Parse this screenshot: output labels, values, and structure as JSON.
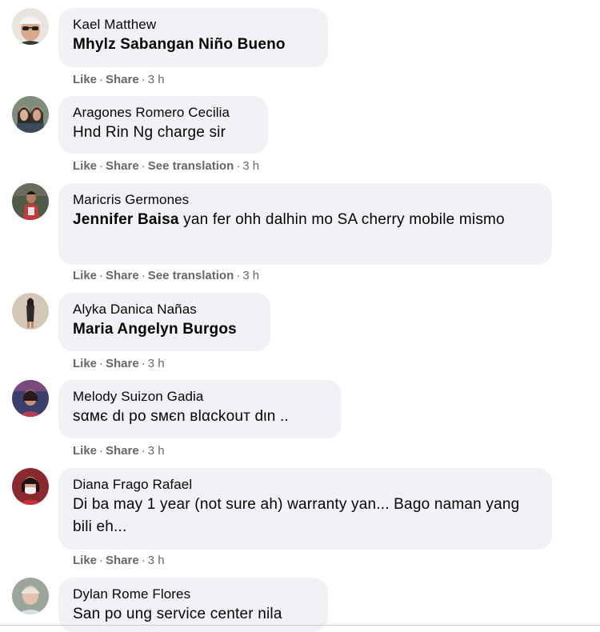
{
  "comments": [
    {
      "author": "Kael Matthew",
      "mention": "Mhylz Sabangan Niño Bueno",
      "text": "",
      "actions": {
        "like": "Like",
        "share": "Share",
        "translate": "",
        "time": "3 h"
      }
    },
    {
      "author": "Aragones Romero Cecilia",
      "mention": "",
      "text": "Hnd Rin Ng charge sir",
      "actions": {
        "like": "Like",
        "share": "Share",
        "translate": "See translation",
        "time": "3 h"
      }
    },
    {
      "author": "Maricris Germones",
      "mention": "Jennifer Baisa",
      "text": " yan fer ohh dalhin mo SA cherry mobile mismo",
      "actions": {
        "like": "Like",
        "share": "Share",
        "translate": "See translation",
        "time": "3 h"
      }
    },
    {
      "author": "Alyka Danica Nañas",
      "mention": "Maria Angelyn Burgos",
      "text": "",
      "actions": {
        "like": "Like",
        "share": "Share",
        "translate": "",
        "time": "3 h"
      }
    },
    {
      "author": "Melody Suizon Gadia",
      "mention": "",
      "text": "sαмє dι po ѕмєn вlαckouт dιn ..",
      "actions": {
        "like": "Like",
        "share": "Share",
        "translate": "",
        "time": "3 h"
      }
    },
    {
      "author": "Diana Frago Rafael",
      "mention": "",
      "text": "Di ba may 1 year (not sure ah) warranty yan... Bago naman yang bili eh...",
      "actions": {
        "like": "Like",
        "share": "Share",
        "translate": "",
        "time": "3 h"
      }
    },
    {
      "author": "Dylan Rome Flores",
      "mention": "",
      "text": "San po ung service center nila",
      "actions": {
        "like": "",
        "share": "",
        "translate": "",
        "time": ""
      }
    }
  ],
  "separator": "·",
  "colors": {
    "bubble": "#f0f2f5",
    "meta": "#65676b",
    "text": "#050505"
  }
}
